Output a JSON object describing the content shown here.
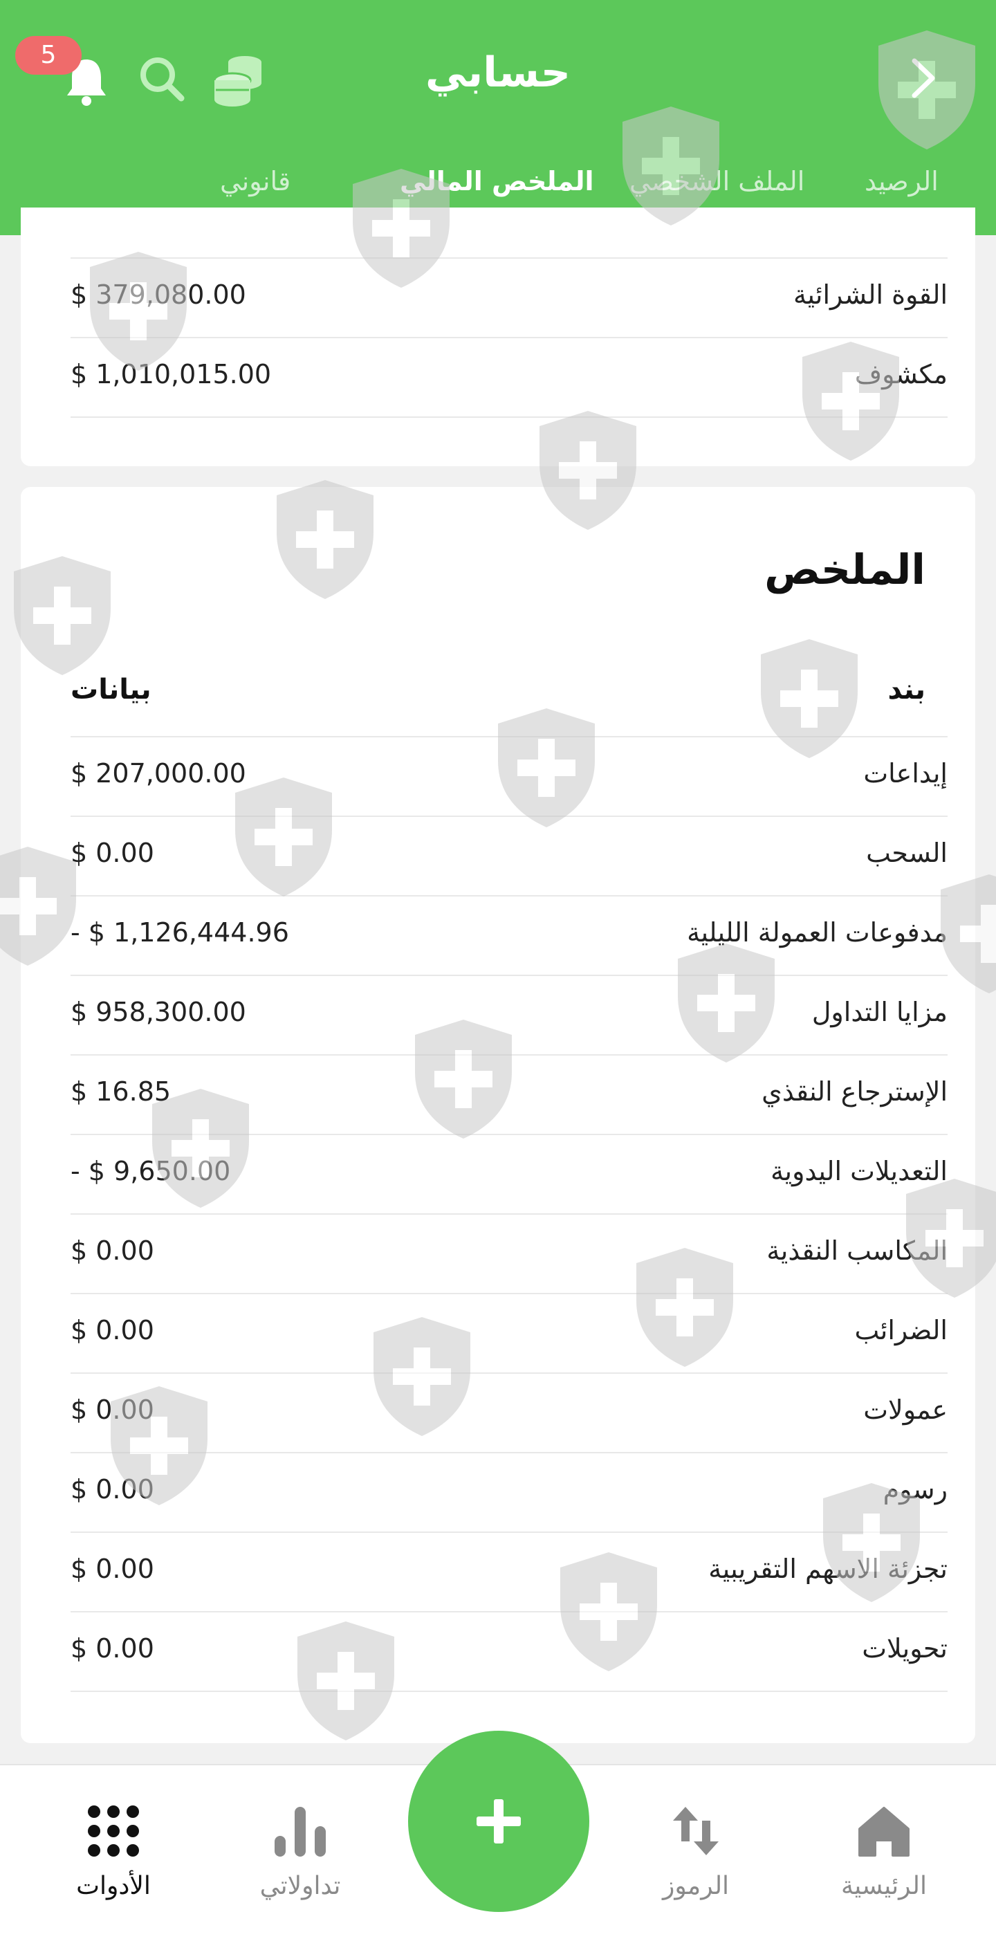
{
  "header": {
    "title": "حسابي",
    "notification_count": "5",
    "tabs": [
      {
        "label": "الرصيد"
      },
      {
        "label": "الملف الشخصي"
      },
      {
        "label": "الملخص المالي"
      },
      {
        "label": "قانوني"
      }
    ],
    "active_tab": "الملخص المالي",
    "accent_color": "#5cc85a"
  },
  "account_card": {
    "rows": [
      {
        "label": "القوة الشرائية",
        "value": "$ 379,080.00"
      },
      {
        "label": "مكشوف",
        "value": "$ 1,010,015.00"
      }
    ]
  },
  "summary": {
    "title": "الملخص",
    "column_item": "بند",
    "column_data": "بيانات",
    "rows": [
      {
        "label": "إيداعات",
        "value": "$ 207,000.00"
      },
      {
        "label": "السحب",
        "value": "$ 0.00"
      },
      {
        "label": "مدفوعات العمولة الليلية",
        "value": "- $ 1,126,444.96"
      },
      {
        "label": "مزايا التداول",
        "value": "$ 958,300.00"
      },
      {
        "label": "الإسترجاع النقذي",
        "value": "$ 16.85"
      },
      {
        "label": "التعديلات اليدوية",
        "value": "- $ 9,650.00"
      },
      {
        "label": "المكاسب النقذية",
        "value": "$ 0.00"
      },
      {
        "label": "الضرائب",
        "value": "$ 0.00"
      },
      {
        "label": "عمولات",
        "value": "$ 0.00"
      },
      {
        "label": "رسوم",
        "value": "$ 0.00"
      },
      {
        "label": "تجزئة الاسهم التقريبية",
        "value": "$ 0.00"
      },
      {
        "label": "تحويلات",
        "value": "$ 0.00"
      }
    ]
  },
  "bottom_nav": {
    "items": [
      {
        "label": "الرئيسية",
        "icon": "home-icon"
      },
      {
        "label": "الرموز",
        "icon": "swap-arrows-icon"
      },
      {
        "label": "تداولاتي",
        "icon": "bar-chart-icon"
      },
      {
        "label": "الأدوات",
        "icon": "grid-dots-icon"
      }
    ],
    "active": "الأدوات",
    "fab_icon": "plus-icon"
  }
}
